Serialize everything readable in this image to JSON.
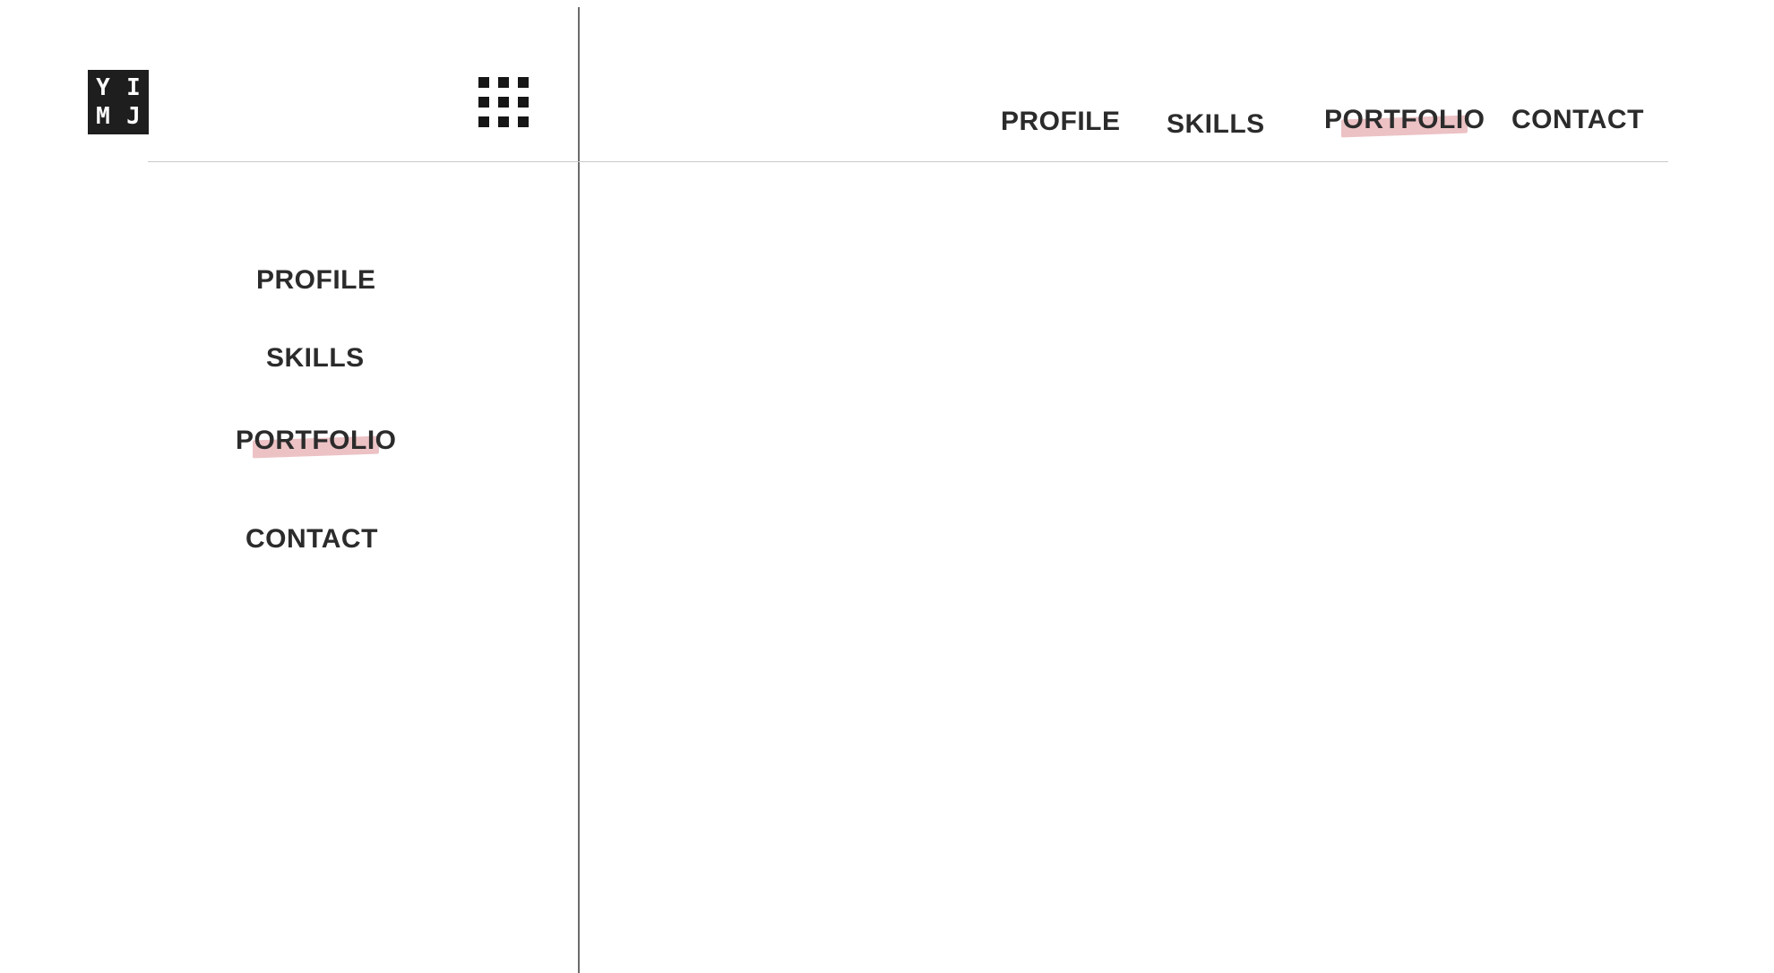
{
  "logo": {
    "row1": [
      "Y",
      "I"
    ],
    "row2": [
      "M",
      "J"
    ],
    "background": "#1e1e1e",
    "foreground": "#ffffff"
  },
  "menu_icon": {
    "name": "grid-menu-icon",
    "dots": 9
  },
  "top_nav": {
    "items": [
      {
        "id": "profile",
        "label": "PROFILE"
      },
      {
        "id": "skills",
        "label": "SKILLS"
      },
      {
        "id": "portfolio",
        "first": "P",
        "highlighted": "ORTFOLI",
        "last": "O",
        "active": true
      },
      {
        "id": "contact",
        "label": "CONTACT"
      }
    ]
  },
  "side_nav": {
    "items": [
      {
        "id": "profile",
        "label": "PROFILE"
      },
      {
        "id": "skills",
        "label": "SKILLS"
      },
      {
        "id": "portfolio",
        "first": "P",
        "highlighted": "ORTFOLI",
        "last": "O",
        "active": true
      },
      {
        "id": "contact",
        "label": "CONTACT"
      }
    ]
  },
  "colors": {
    "text": "#2b2b2b",
    "highlight": "#c9505a",
    "divider_vertical": "#6b6b6b",
    "divider_horizontal": "#c9c9c9"
  }
}
